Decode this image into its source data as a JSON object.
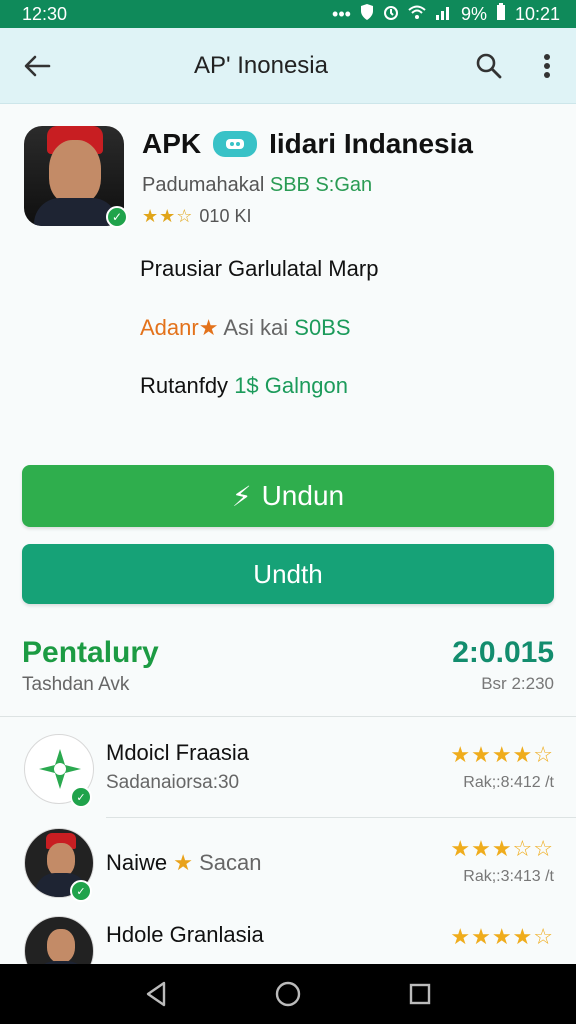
{
  "status": {
    "time_left": "12:30",
    "battery_text": "9%",
    "time_right": "10:21"
  },
  "app_bar": {
    "title": "AP' Inonesia"
  },
  "app": {
    "name_prefix": "APK",
    "name_suffix": "Iidari Indanesia",
    "developer": "Padumahakal",
    "price": "SBB S:Gan",
    "rating_text": "010 KI",
    "stars": "★★☆"
  },
  "info": {
    "line1": "Prausiar Garlulatal Marp",
    "line2_highlight": "Adanr★",
    "line2_rest": "Asi kai",
    "line2_value": "S0BS",
    "line3_prefix": "Rutanfdy",
    "line3_value": "1$ Galngon"
  },
  "buttons": {
    "primary_icon": "⚡",
    "primary_label": "Undun",
    "secondary_label": "Undth"
  },
  "section": {
    "title": "Pentalury",
    "value": "2:0.015",
    "subtitle": "Tashdan Avk",
    "subtitle_right_a": "Bsr",
    "subtitle_right_b": "2:230"
  },
  "list": [
    {
      "title": "Mdoicl Fraasia",
      "subtitle": "Sadanaiorsa:30",
      "stars": "★★★★☆",
      "meta": "Rak;:8:412 /t"
    },
    {
      "title": "Naiwe",
      "subtitle_star": "★",
      "subtitle": "Sacan",
      "stars": "★★★☆☆",
      "meta": "Rak;:3:413 /t"
    },
    {
      "title": "Hdole Granlasia",
      "subtitle": "",
      "stars": "★★★★☆",
      "meta": ""
    }
  ]
}
